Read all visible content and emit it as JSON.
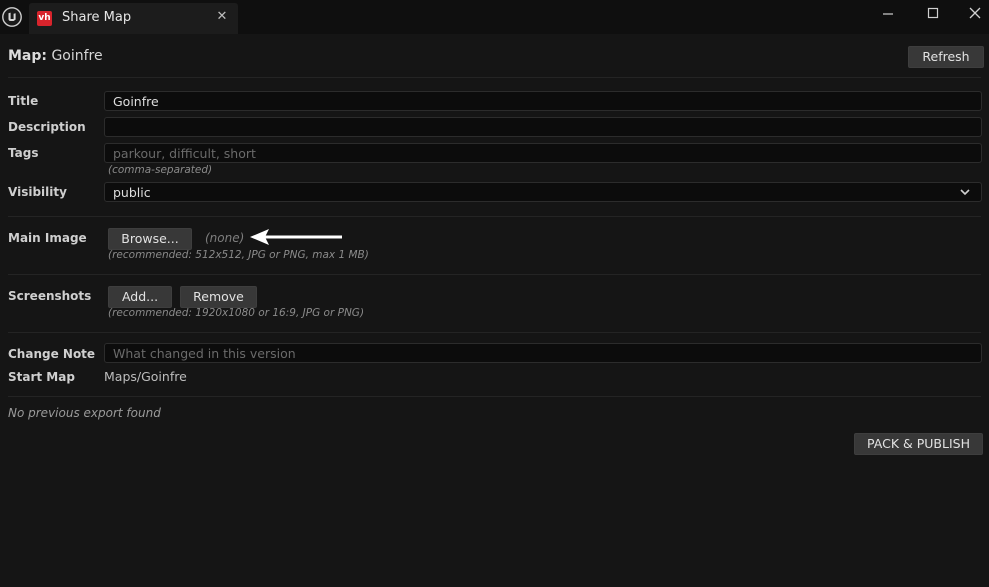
{
  "window": {
    "tab_title": "Share Map",
    "tab_icon_text": "vh",
    "icons": {
      "app_logo": "unreal-logo-icon",
      "close": "close-icon",
      "minimize": "minimize-icon",
      "maximize": "maximize-icon"
    }
  },
  "header": {
    "map_label": "Map:",
    "map_name": "Goinfre",
    "refresh_label": "Refresh"
  },
  "form": {
    "title": {
      "label": "Title",
      "value": "Goinfre"
    },
    "description": {
      "label": "Description",
      "value": ""
    },
    "tags": {
      "label": "Tags",
      "placeholder": "parkour, difficult, short",
      "hint": "(comma-separated)"
    },
    "visibility": {
      "label": "Visibility",
      "value": "public"
    },
    "main_image": {
      "label": "Main Image",
      "browse_label": "Browse...",
      "current": "(none)",
      "hint": "(recommended: 512x512, JPG or PNG, max 1 MB)"
    },
    "screenshots": {
      "label": "Screenshots",
      "add_label": "Add...",
      "remove_label": "Remove",
      "hint": "(recommended: 1920x1080 or 16:9, JPG or PNG)"
    },
    "change_note": {
      "label": "Change Note",
      "placeholder": "What changed in this version"
    },
    "start_map": {
      "label": "Start Map",
      "value": "Maps/Goinfre"
    }
  },
  "status": {
    "export_status": "No previous export found"
  },
  "actions": {
    "publish_label": "PACK & PUBLISH"
  },
  "colors": {
    "background": "#151515",
    "field_bg": "#0c0c0c",
    "button_bg": "#383838",
    "tab_icon": "#d8242c"
  }
}
